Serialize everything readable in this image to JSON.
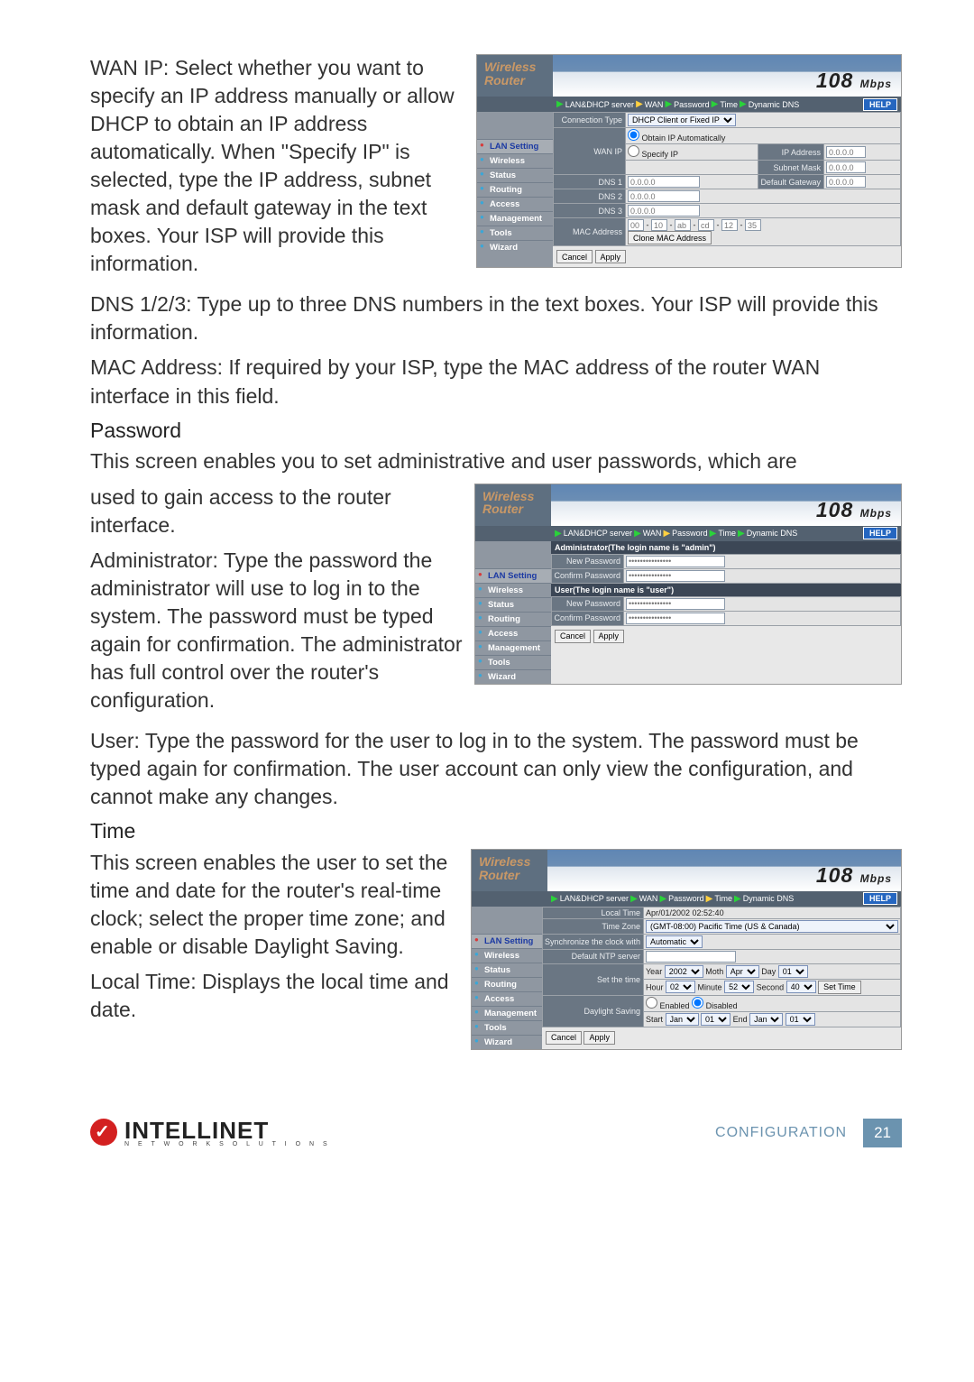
{
  "doc": {
    "p_wanip": "WAN IP: Select whether you want to specify an IP address manually or allow DHCP to obtain an IP address automatically. When \"Specify IP\" is selected, type the IP address, subnet mask and default gateway in the text boxes. Your ISP will provide this information.",
    "p_dns": "DNS 1/2/3: Type up to three DNS numbers in the text boxes. Your ISP will provide this information.",
    "p_mac": "MAC Address: If required by your ISP, type the MAC address of the router WAN interface in this field.",
    "h_pwd": "Password",
    "p_pwd_intro": "This screen enables you to set administrative and user passwords, which are",
    "p_pwd_wrap": "used to gain access to the router interface.",
    "p_admin": "Administrator: Type the password the administrator will use to log in to the system. The password must be typed again for confirmation. The administrator has full control over the router's configuration.",
    "p_user": "User: Type the password for the user to log in to the system. The password must be typed again for confirmation. The user account can only view the configuration, and cannot make any changes.",
    "h_time": "Time",
    "p_time_wrap": "This screen enables the user to set the time and date for the router's real-time clock; select the proper time zone; and enable or disable Daylight Saving.",
    "p_localtime": "Local Time: Displays the local time and date."
  },
  "brand": {
    "l1": "Wireless",
    "l2": "Router",
    "mbps": "108",
    "mbps_unit": "Mbps"
  },
  "crumbs": {
    "items": [
      "LAN&DHCP server",
      "WAN",
      "Password",
      "Time",
      "Dynamic DNS"
    ],
    "help": "HELP"
  },
  "sidebar": {
    "items": [
      "LAN Setting",
      "Wireless",
      "Status",
      "Routing",
      "Access",
      "Management",
      "Tools",
      "Wizard"
    ]
  },
  "wan": {
    "conn_type_label": "Connection Type",
    "conn_type_value": "DHCP Client or Fixed IP",
    "wanip_label": "WAN IP",
    "obtain": "Obtain IP Automatically",
    "specify": "Specify IP",
    "ip_label": "IP Address",
    "ip_ph": "0.0.0.0",
    "mask_label": "Subnet Mask",
    "mask_ph": "0.0.0.0",
    "gw_label": "Default Gateway",
    "gw_ph": "0.0.0.0",
    "dns1": "DNS 1",
    "dns2": "DNS 2",
    "dns3": "DNS 3",
    "dns_ph": "0.0.0.0",
    "mac_label": "MAC Address",
    "mac": [
      "00",
      "10",
      "ab",
      "cd",
      "12",
      "35"
    ],
    "clone": "Clone MAC Address",
    "cancel": "Cancel",
    "apply": "Apply"
  },
  "pwd": {
    "admin_header": "Administrator(The login name is \"admin\")",
    "user_header": "User(The login name is \"user\")",
    "new_pw": "New Password",
    "conf_pw": "Confirm Password",
    "mask": "***************",
    "cancel": "Cancel",
    "apply": "Apply"
  },
  "time": {
    "local_label": "Local Time",
    "local_value": "Apr/01/2002 02:52:40",
    "tz_label": "Time Zone",
    "tz_value": "(GMT-08:00) Pacific Time (US & Canada)",
    "sync_label": "Synchronize the clock with",
    "sync_value": "Automatic",
    "ntp_label": "Default NTP server",
    "set_label": "Set the time",
    "year_l": "Year",
    "year_v": "2002",
    "month_l": "Moth",
    "month_v": "Apr",
    "day_l": "Day",
    "day_v": "01",
    "hour_l": "Hour",
    "hour_v": "02",
    "min_l": "Minute",
    "min_v": "52",
    "sec_l": "Second",
    "sec_v": "40",
    "settime_btn": "Set Time",
    "ds_label": "Daylight Saving",
    "enabled": "Enabled",
    "disabled": "Disabled",
    "start_l": "Start",
    "end_l": "End",
    "m1": "Jan",
    "d1": "01",
    "m2": "Jan",
    "d2": "01",
    "cancel": "Cancel",
    "apply": "Apply"
  },
  "footer": {
    "brand": "INTELLINET",
    "sub": "N E T W O R K   S O L U T I O N S",
    "section": "CONFIGURATION",
    "page": "21"
  }
}
